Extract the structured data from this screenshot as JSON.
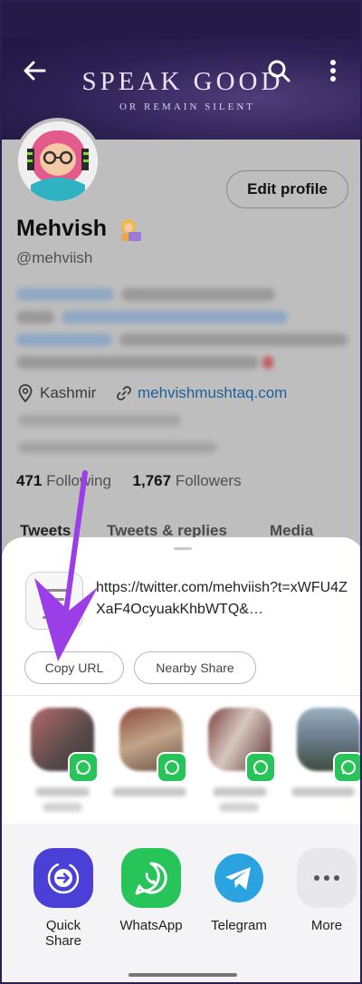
{
  "banner": {
    "title": "SPEAK GOOD",
    "subtitle": "OR REMAIN SILENT"
  },
  "profile": {
    "edit_label": "Edit profile",
    "name": "Mehvish",
    "handle": "@mehviish",
    "location": "Kashmir",
    "website": "mehvishmushtaq.com",
    "following_count": "471",
    "following_label": "Following",
    "followers_count": "1,767",
    "followers_label": "Followers",
    "tabs": [
      "Tweets",
      "Tweets & replies",
      "Media"
    ]
  },
  "share_sheet": {
    "url": "https://twitter.com/mehviish?t=xWFU4ZXaF4OcyuakKhbWTQ&…",
    "copy_url_label": "Copy URL",
    "nearby_share_label": "Nearby Share",
    "apps": [
      {
        "label": "Quick Share",
        "icon": "quick-share-icon",
        "color": "#4a3fd6"
      },
      {
        "label": "WhatsApp",
        "icon": "whatsapp-icon",
        "color": "#27c45a"
      },
      {
        "label": "Telegram",
        "icon": "telegram-icon",
        "color": "#2aa3e0"
      },
      {
        "label": "More",
        "icon": "more-icon",
        "color": "#e8e8ea"
      }
    ]
  },
  "colors": {
    "annotation_arrow": "#9b3ee8",
    "link": "#1f5f99"
  }
}
